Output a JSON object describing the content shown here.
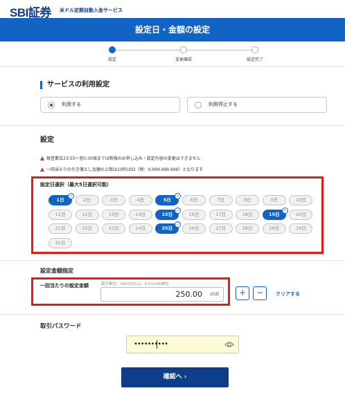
{
  "header": {
    "logo": "SBI証券",
    "service_name": "米ドル定期自動入金サービス",
    "page_title": "設定日・金額の設定"
  },
  "steps": [
    {
      "label": "設定",
      "active": true
    },
    {
      "label": "変更確認",
      "active": false
    },
    {
      "label": "設定完了",
      "active": false
    }
  ],
  "service_usage": {
    "title": "サービスの利用設定",
    "options": [
      {
        "label": "利用する",
        "selected": true
      },
      {
        "label": "利用停止する",
        "selected": false
      }
    ]
  },
  "settings": {
    "title": "設定",
    "warnings": [
      "毎営業日23:55〜翌0:30頃までは新規のお申し込み・設定内容の変更はできません",
      "一回当たりの引き落とし金額の上限は10桁USD（例：9,999,999,999）となります"
    ]
  },
  "day_selection": {
    "title": "設定日選択（最大5日選択可能）",
    "days": [
      "1日",
      "2日",
      "3日",
      "4日",
      "5日",
      "6日",
      "7日",
      "8日",
      "9日",
      "10日",
      "11日",
      "12日",
      "13日",
      "14日",
      "15日",
      "16日",
      "17日",
      "18日",
      "19日",
      "20日",
      "21日",
      "22日",
      "23日",
      "24日",
      "25日",
      "26日",
      "27日",
      "28日",
      "29日",
      "30日",
      "31日"
    ],
    "selected": [
      1,
      5,
      15,
      19,
      25
    ],
    "check_mark": "✓"
  },
  "amount": {
    "section_title": "設定金額指定",
    "label": "一回当たりの設定金額",
    "hint": "取引単位：10USD以上、0.01USD単位",
    "value": "250.00",
    "unit": "USD",
    "plus_label": "+",
    "minus_label": "−",
    "clear_label": "クリアする"
  },
  "password": {
    "title": "取引パスワード",
    "masked_value": "••••••••••"
  },
  "confirm_button": "確認へ ›",
  "colors": {
    "brand_blue": "#1264c4",
    "dark_navy": "#0e3d8a",
    "highlight_red": "#e01b1b",
    "warning_red": "#d32f2f",
    "password_bg": "#fdfbd6"
  }
}
